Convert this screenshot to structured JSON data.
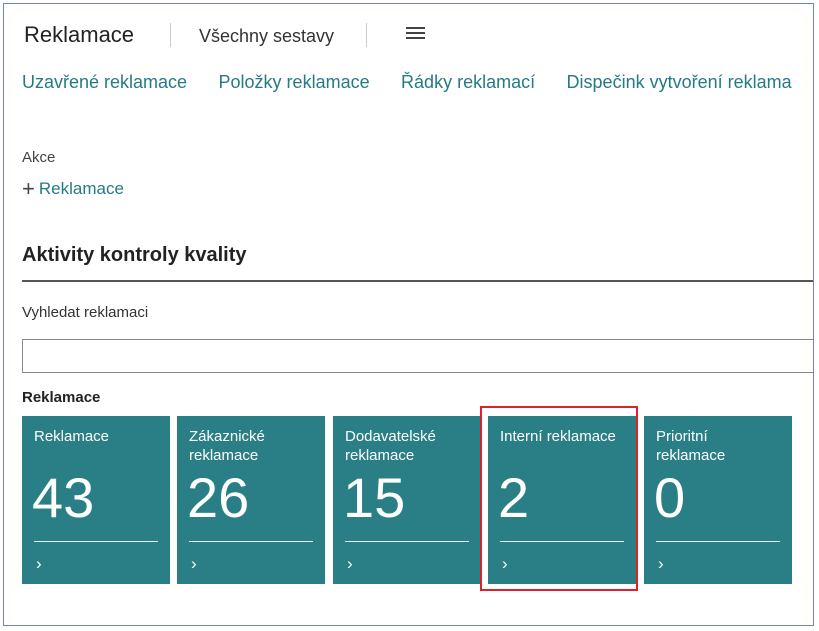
{
  "header": {
    "title": "Reklamace",
    "all_reports": "Všechny sestavy"
  },
  "nav": [
    "Uzavřené reklamace",
    "Položky reklamace",
    "Řádky reklamací",
    "Dispečink vytvoření reklama"
  ],
  "actions": {
    "label": "Akce",
    "new_label": "Reklamace"
  },
  "section": {
    "title": "Aktivity kontroly kvality",
    "search_label": "Vyhledat reklamaci",
    "search_value": "",
    "group_label": "Reklamace"
  },
  "tiles": [
    {
      "label": "Reklamace",
      "value": "43"
    },
    {
      "label": "Zákaznické reklamace",
      "value": "26"
    },
    {
      "label": "Dodavatelské reklamace",
      "value": "15"
    },
    {
      "label": "Interní reklamace",
      "value": "2"
    },
    {
      "label": "Prioritní reklamace",
      "value": "0"
    }
  ],
  "colors": {
    "tile_bg": "#2a7f87",
    "link": "#257a86",
    "highlight": "#e0202a"
  }
}
